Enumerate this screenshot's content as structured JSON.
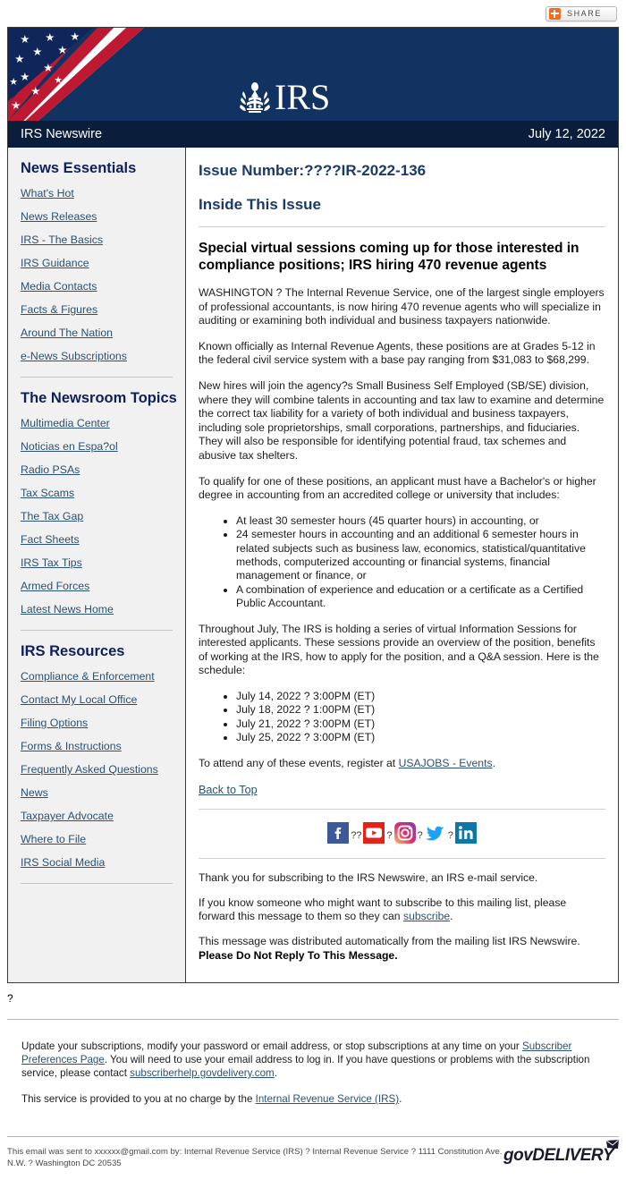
{
  "share": {
    "label": "SHARE",
    "icon": "share-plus-icon",
    "accent": "#f26c21"
  },
  "masthead": {
    "logo_text": "IRS",
    "seal_icon": "irs-eagle-seal-icon",
    "flag_icon": "us-flag-diagonal-icon",
    "bg": "#123262"
  },
  "newswire": {
    "title": "IRS Newswire",
    "date": "July 12, 2022",
    "bg": "#0a1e3c"
  },
  "sidebar": {
    "sections": [
      {
        "heading": "News Essentials",
        "links": [
          "What's Hot",
          "News Releases",
          "IRS - The Basics",
          "IRS Guidance",
          "Media Contacts",
          "Facts & Figures",
          "Around The Nation",
          "e-News Subscriptions"
        ]
      },
      {
        "heading": "The Newsroom Topics",
        "links": [
          "Multimedia Center",
          "Noticias en Espa?ol",
          "Radio PSAs",
          "Tax Scams",
          "The Tax Gap",
          "Fact Sheets",
          "IRS Tax Tips",
          "Armed Forces",
          "Latest News Home"
        ]
      },
      {
        "heading": "IRS Resources",
        "links": [
          "Compliance & Enforcement",
          "Contact My Local Office",
          "Filing Options",
          "Forms & Instructions",
          "Frequently Asked Questions",
          "News",
          "Taxpayer Advocate",
          "Where to File",
          "IRS Social Media"
        ]
      }
    ]
  },
  "content": {
    "issue_number": "Issue Number:????IR-2022-136",
    "inside_this_issue": "Inside This Issue",
    "headline": "Special virtual sessions coming up for those interested in compliance positions; IRS hiring 470 revenue agents",
    "p1": "WASHINGTON ? The Internal Revenue Service, one of the largest single employers of professional accountants, is now hiring 470 revenue agents who will specialize in auditing or examining both individual and business taxpayers nationwide.",
    "p2": "Known officially as Internal Revenue Agents, these positions are at Grades 5-12 in the federal civil service system with a base pay ranging from $31,083 to $68,299.",
    "p3": "New hires will join the agency?s Small Business Self Employed (SB/SE) division, where they will combine talents in accounting and tax law to examine and determine the correct tax liability for a variety of both individual and business taxpayers, including sole proprietorships, small corporations, partnerships, and fiduciaries. They will also be responsible for identifying potential fraud, tax schemes and abusive tax shelters.",
    "p4": "To qualify for one of these positions, an applicant must have a Bachelor's or higher degree in accounting from an accredited college or university that includes:",
    "qualifications": [
      "At least 30 semester hours (45 quarter hours) in accounting, or",
      "24 semester hours in accounting and an additional 6 semester hours in related subjects such as business law, economics, statistical/quantitative methods, computerized accounting or financial systems, financial management or finance, or",
      "A combination of experience and education or a certificate as a Certified Public Accountant."
    ],
    "p5": "Throughout July, The IRS is holding a series of virtual Information Sessions for interested applicants. These sessions provide an overview of the position, benefits of working at the IRS, how to apply for the position, and a Q&A session. Here is the schedule:",
    "schedule": [
      "July 14, 2022 ? 3:00PM (ET)",
      "July 18, 2022 ? 1:00PM (ET)",
      "July 21, 2022 ? 3:00PM (ET)",
      "July 25, 2022 ? 3:00PM (ET)"
    ],
    "register_prefix": "To attend any of these events, register at ",
    "register_link": "USAJOBS - Events",
    "register_suffix": ".",
    "back_to_top": "Back to Top"
  },
  "social": {
    "icons": [
      "facebook-icon",
      "youtube-icon",
      "instagram-icon",
      "twitter-icon",
      "linkedin-icon"
    ],
    "separators": [
      "??",
      "?",
      "?",
      "?"
    ]
  },
  "closing": {
    "thanks": "Thank you for subscribing to the IRS Newswire, an IRS e-mail service.",
    "forward_prefix": "If you know someone who might want to subscribe to this mailing list, please forward this message to them so they can ",
    "forward_link": "subscribe",
    "forward_suffix": ".",
    "distributed": "This message was distributed automatically from the mailing list IRS Newswire.",
    "do_not_reply": "Please Do Not Reply To This Message."
  },
  "footer": {
    "stray_marker": "?",
    "update_prefix": "Update your subscriptions, modify your password or email address, or stop subscriptions at any time on your ",
    "prefs_link": "Subscriber Preferences Page",
    "update_mid": ". You will need to use your email address to log in. If you have questions or problems with the subscription service, please contact ",
    "help_link": "subscriberhelp.govdelivery.com",
    "update_suffix": ".",
    "no_charge_prefix": "This service is provided to you at no charge by the ",
    "irs_link": "Internal Revenue Service (IRS)",
    "no_charge_suffix": ".",
    "sent_to": "This email was sent to xxxxxx@gmail.com by: Internal Revenue Service (IRS) ? Internal Revenue Service ? 1111 Constitution Ave. N.W. ? Washington DC 20535",
    "govdelivery": "govDELIVERY",
    "govdelivery_icon": "envelope-icon"
  }
}
